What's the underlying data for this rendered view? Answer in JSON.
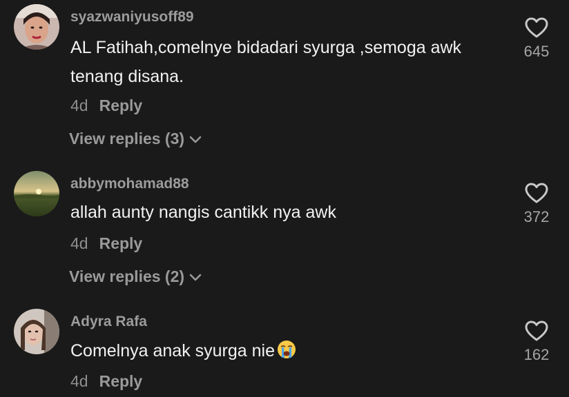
{
  "comments": [
    {
      "username": "syazwaniyusoff89",
      "text": "AL Fatihah,comelnye bidadari syurga ,semoga awk tenang disana.",
      "time": "4d",
      "reply_label": "Reply",
      "view_replies": "View replies (3)",
      "likes": "645"
    },
    {
      "username": "abbymohamad88",
      "text": "allah aunty nangis cantikk nya awk",
      "time": "4d",
      "reply_label": "Reply",
      "view_replies": "View replies (2)",
      "likes": "372"
    },
    {
      "username": "Adyra Rafa",
      "text": "Comelnya anak syurga nie",
      "time": "4d",
      "reply_label": "Reply",
      "likes": "162",
      "emoji": "loudly-crying-face-emoji"
    }
  ],
  "icons": {
    "like": "heart-outline-icon",
    "expand": "chevron-down-icon"
  },
  "colors": {
    "background": "#1a1a1a",
    "username": "#9c9c9c",
    "text": "#f2f2f2",
    "secondary": "#9a9a9a"
  }
}
